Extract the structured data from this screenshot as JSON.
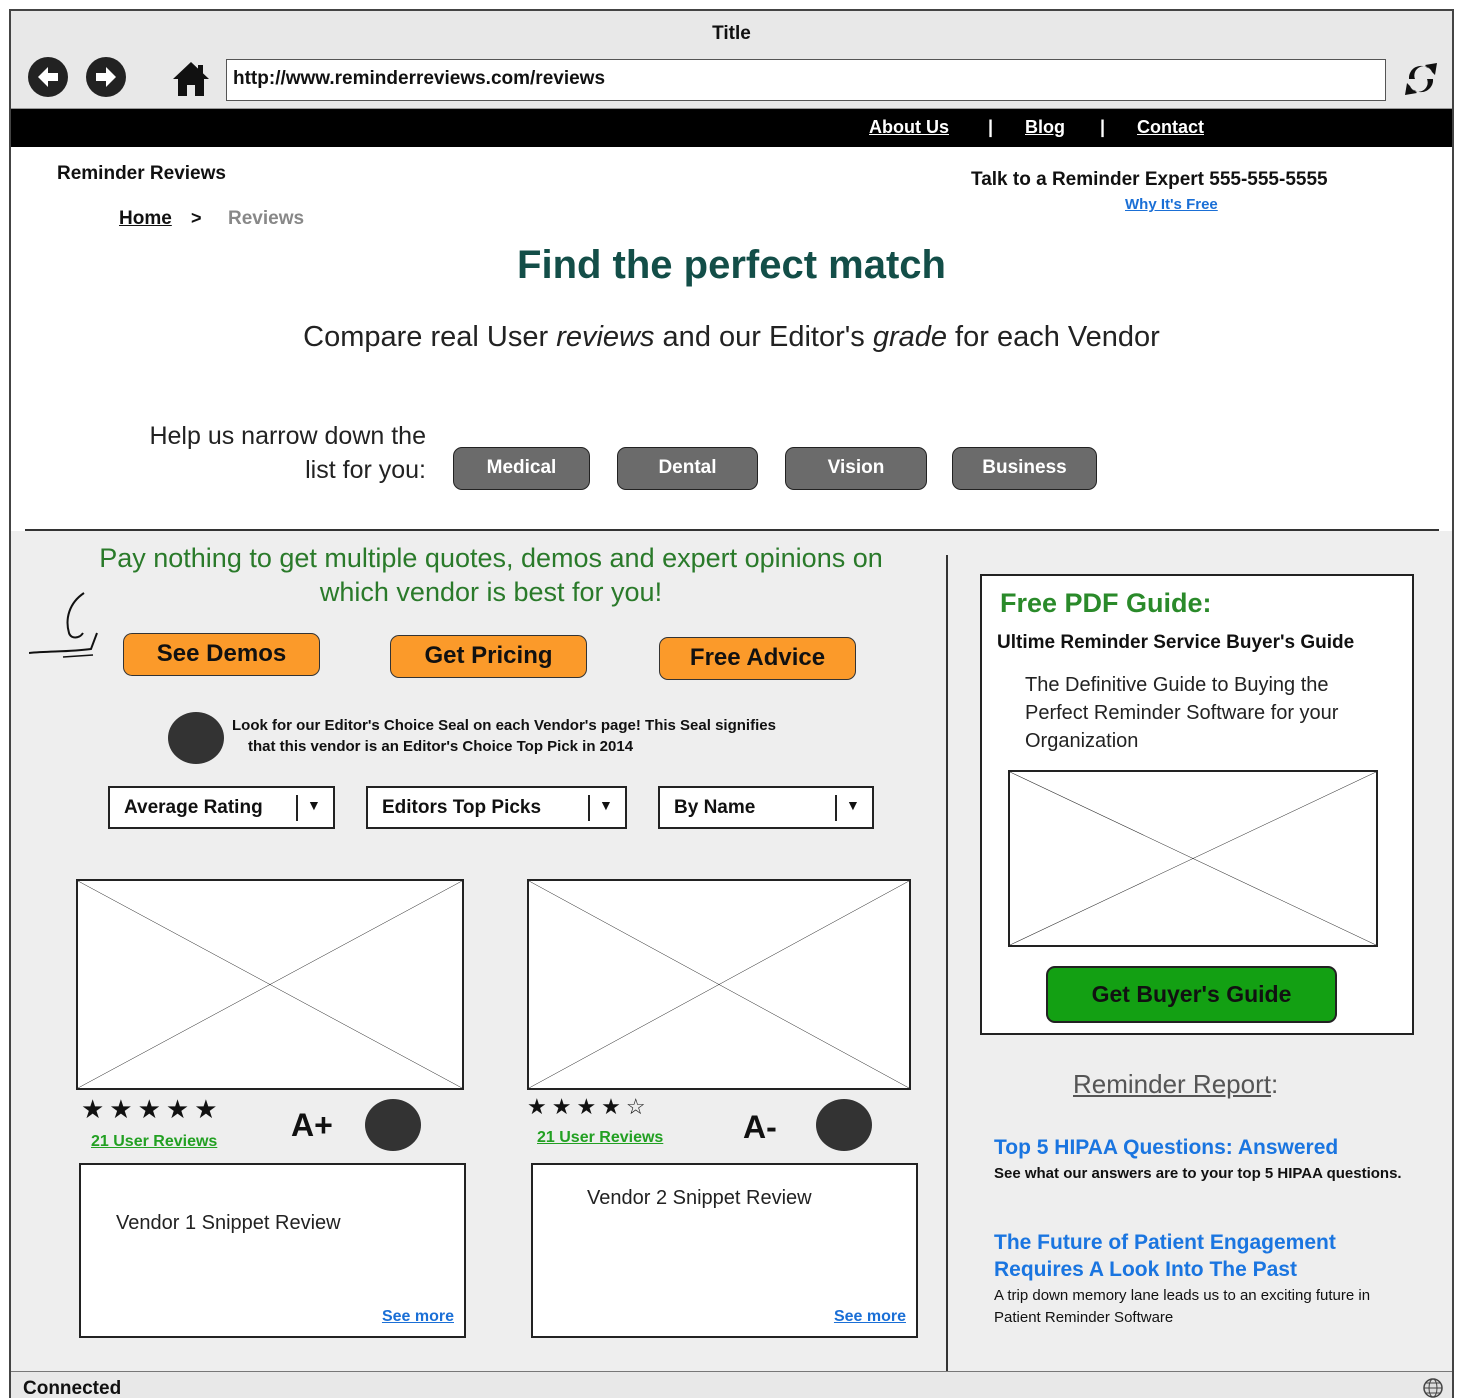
{
  "window": {
    "title": "Title",
    "url": "http://www.reminderreviews.com/reviews",
    "status": "Connected"
  },
  "topnav": {
    "about": "About Us",
    "sep": "|",
    "blog": "Blog",
    "contact": "Contact"
  },
  "header": {
    "brand": "Reminder Reviews",
    "expert": "Talk to a Reminder Expert 555-555-5555",
    "why_free": "Why It's Free",
    "breadcrumb": {
      "home": "Home",
      "sep": ">",
      "current": "Reviews"
    }
  },
  "hero": {
    "headline": "Find the perfect match",
    "sub_pre": "Compare real User ",
    "sub_em1": "reviews",
    "sub_mid": " and our Editor's ",
    "sub_em2": "grade",
    "sub_post": " for each Vendor",
    "narrow_line1": "Help us narrow down the",
    "narrow_line2": "list for you:",
    "categories": [
      "Medical",
      "Dental",
      "Vision",
      "Business"
    ]
  },
  "promo": {
    "text_line1": "Pay nothing to get multiple quotes, demos and expert opinions on",
    "text_line2": "which vendor is best for you!",
    "buttons": [
      "See Demos",
      "Get Pricing",
      "Free Advice"
    ],
    "seal_line1": "Look for our Editor's Choice Seal on each Vendor's page! This Seal signifies",
    "seal_line2": "that this vendor is an Editor's Choice Top Pick in 2014"
  },
  "filters": [
    "Average Rating",
    "Editors Top Picks",
    "By Name"
  ],
  "filter_arrow": "▼",
  "vendors": [
    {
      "stars": "★★★★★",
      "rating": 5,
      "reviews": "21 User Reviews",
      "grade": "A+",
      "snippet": "Vendor 1 Snippet Review",
      "see_more": "See more"
    },
    {
      "stars": "★★★★☆",
      "rating": 4,
      "reviews": "21 User Reviews",
      "grade": "A-",
      "snippet": "Vendor 2 Snippet Review",
      "see_more": "See more"
    }
  ],
  "sidebar": {
    "guide_title": "Free PDF Guide:",
    "guide_sub": "Ultime Reminder Service Buyer's Guide",
    "guide_desc": "The Definitive Guide to Buying the Perfect Reminder Software for your Organization",
    "guide_button": "Get Buyer's Guide",
    "report_title": "Reminder Report",
    "report_colon": ":",
    "articles": [
      {
        "title": "Top 5 HIPAA Questions: Answered",
        "desc": "See what our answers are to your top 5 HIPAA questions."
      },
      {
        "title": "The Future of Patient Engagement Requires A Look Into The Past",
        "desc": "A trip down memory lane leads us to an exciting future in Patient Reminder Software"
      }
    ]
  },
  "colors": {
    "accent_green": "#2a8a2a",
    "link_blue": "#1a75e0",
    "orange": "#fb9a2a",
    "headline": "#134e48"
  }
}
